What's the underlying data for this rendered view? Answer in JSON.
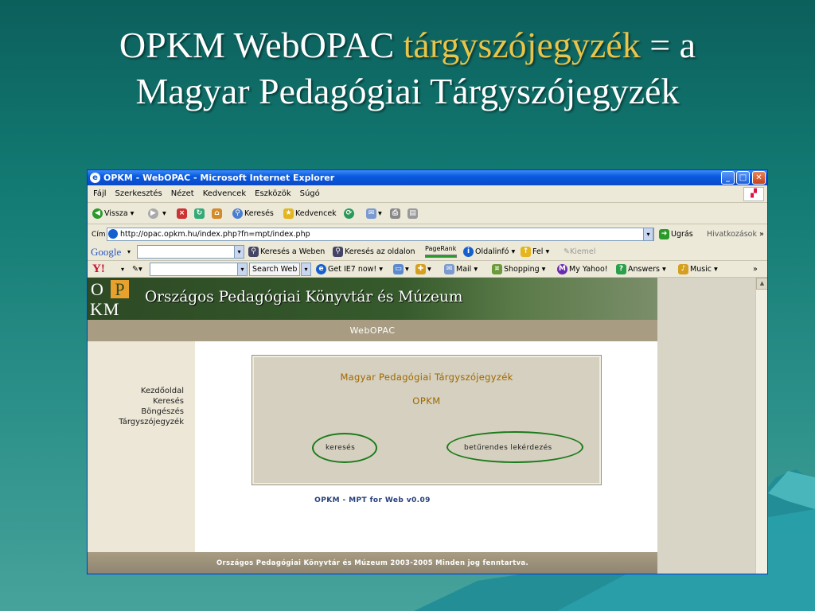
{
  "slide": {
    "title_part1": "OPKM WebOPAC ",
    "title_highlight": "tárgyszójegyzék",
    "title_part2": " = a",
    "title_line2": "Magyar Pedagógiai Tárgyszójegyzék"
  },
  "window": {
    "title": "OPKM - WebOPAC - Microsoft Internet Explorer",
    "buttons": {
      "minimize": "_",
      "maximize": "□",
      "close": "✕"
    }
  },
  "menubar": {
    "items": [
      "Fájl",
      "Szerkesztés",
      "Nézet",
      "Kedvencek",
      "Eszközök",
      "Súgó"
    ]
  },
  "toolbar": {
    "back_label": "Vissza",
    "search_label": "Keresés",
    "favorites_label": "Kedvencek"
  },
  "address": {
    "label": "Cím",
    "url": "http://opac.opkm.hu/index.php?fn=mpt/index.php",
    "go_label": "Ugrás",
    "links_label": "Hivatkozások"
  },
  "google_bar": {
    "logo": "Google",
    "search_web_label": "Keresés a Weben",
    "search_site_label": "Keresés az oldalon",
    "pagerank_label": "PageRank",
    "pageinfo_label": "Oldalinfó",
    "up_label": "Fel",
    "highlight_label": "Kiemel"
  },
  "yahoo_bar": {
    "logo": "Y!",
    "search_web_label": "Search Web",
    "get_ie7_label": "Get IE7 now!",
    "mail_label": "Mail",
    "shopping_label": "Shopping",
    "myyahoo_label": "My Yahoo!",
    "answers_label": "Answers",
    "music_label": "Music",
    "more": "»"
  },
  "page": {
    "logo_o": "O",
    "logo_p": "P",
    "logo_km": "KM",
    "banner_title": "Országos Pedagógiai Könyvtár és Múzeum",
    "section_title": "WebOPAC",
    "nav": [
      "Kezdőoldal",
      "Keresés",
      "Böngészés",
      "Tárgyszójegyzék"
    ],
    "panel_title": "Magyar Pedagógiai Tárgyszójegyzék",
    "panel_subtitle": "OPKM",
    "link_search": "keresés",
    "link_alpha": "betűrendes lekérdezés",
    "version": "OPKM - MPT for Web v0.09",
    "footer": "Országos Pedagógiai Könyvtár és Múzeum 2003-2005 Minden jog fenntartva."
  },
  "colors": {
    "slide_bg": "#127a72",
    "title_highlight": "#e8c44a",
    "banner": "#365a2c",
    "oval": "#1a7a1a"
  }
}
